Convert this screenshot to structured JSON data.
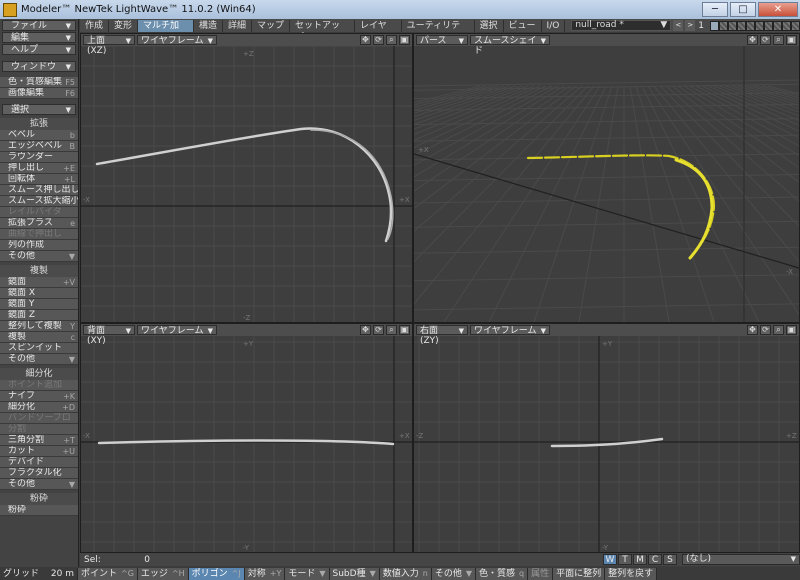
{
  "window": {
    "title": "Modeler™ NewTek LightWave™ 11.0.2 (Win64)",
    "min_label": "─",
    "max_label": "□",
    "close_label": "✕"
  },
  "tabs": [
    "作成",
    "変形",
    "マルチ加工",
    "構造",
    "詳細",
    "マップ",
    "セットアップ",
    "レイヤー",
    "ユーティリティ",
    "選択",
    "ビュー",
    "I/O"
  ],
  "active_tab": "マルチ加工",
  "object_name": "null_road *",
  "layer_index": "1",
  "sidebar": {
    "top_menus": [
      "ファイル",
      "編集",
      "ヘルプ"
    ],
    "window_menu": "ウィンドウ",
    "misc": [
      {
        "label": "色・質感編集",
        "shortcut": "F5"
      },
      {
        "label": "画像編集",
        "shortcut": "F6"
      }
    ],
    "select_menu": "選択",
    "groups": [
      {
        "title": "拡張",
        "items": [
          {
            "label": "ベベル",
            "shortcut": "b",
            "disabled": false
          },
          {
            "label": "エッジベベル",
            "shortcut": "B",
            "disabled": false
          },
          {
            "label": "ラウンダー",
            "shortcut": "",
            "disabled": false
          },
          {
            "label": "押し出し",
            "shortcut": "+E",
            "disabled": false
          },
          {
            "label": "回転体",
            "shortcut": "+L",
            "disabled": false
          },
          {
            "label": "スムース押し出し",
            "shortcut": "+F",
            "disabled": false
          },
          {
            "label": "スムース拡大縮小",
            "shortcut": "",
            "disabled": false
          },
          {
            "label": "レイルバイタ",
            "shortcut": "",
            "disabled": true
          },
          {
            "label": "拡張プラス",
            "shortcut": "e",
            "disabled": false
          },
          {
            "label": "曲線で押出し",
            "shortcut": "",
            "disabled": true
          },
          {
            "label": "列の作成",
            "shortcut": "",
            "disabled": false
          },
          {
            "label": "その他",
            "shortcut": "▼",
            "disabled": false
          }
        ]
      },
      {
        "title": "複製",
        "items": [
          {
            "label": "鏡面",
            "shortcut": "+V",
            "disabled": false
          },
          {
            "label": "鏡面 X",
            "shortcut": "",
            "disabled": false
          },
          {
            "label": "鏡面 Y",
            "shortcut": "",
            "disabled": false
          },
          {
            "label": "鏡面 Z",
            "shortcut": "",
            "disabled": false
          },
          {
            "label": "整列して複製",
            "shortcut": "Y",
            "disabled": false
          },
          {
            "label": "複製",
            "shortcut": "c",
            "disabled": false
          },
          {
            "label": "スピンイット",
            "shortcut": "",
            "disabled": false
          },
          {
            "label": "その他",
            "shortcut": "▼",
            "disabled": false
          }
        ]
      },
      {
        "title": "細分化",
        "items": [
          {
            "label": "ポイント追加",
            "shortcut": "",
            "disabled": true
          },
          {
            "label": "ナイフ",
            "shortcut": "+K",
            "disabled": false
          },
          {
            "label": "細分化",
            "shortcut": "+D",
            "disabled": false
          },
          {
            "label": "バンドソープロ",
            "shortcut": "",
            "disabled": true
          },
          {
            "label": "分割",
            "shortcut": "",
            "disabled": true
          },
          {
            "label": "三角分割",
            "shortcut": "+T",
            "disabled": false
          },
          {
            "label": "カット",
            "shortcut": "+U",
            "disabled": false
          },
          {
            "label": "デバイド",
            "shortcut": "",
            "disabled": false
          },
          {
            "label": "フラクタル化",
            "shortcut": "",
            "disabled": false
          },
          {
            "label": "その他",
            "shortcut": "▼",
            "disabled": false
          }
        ]
      },
      {
        "title": "粉砕",
        "items": [
          {
            "label": "粉砕",
            "shortcut": "",
            "disabled": false
          }
        ]
      }
    ]
  },
  "viewports": {
    "top_left": {
      "view": "上面 (XZ)",
      "mode": "ワイヤフレーム"
    },
    "top_right": {
      "view": "パース",
      "mode": "スムースシェイド"
    },
    "bottom_left": {
      "view": "背面 (XY)",
      "mode": "ワイヤフレーム"
    },
    "bottom_right": {
      "view": "右面 (ZY)",
      "mode": "ワイヤフレーム"
    }
  },
  "icons": {
    "move": "move-icon",
    "rotate": "rotate-icon",
    "zoom": "zoom-icon",
    "maximize": "maximize-icon"
  },
  "axes": {
    "plus_x": "+X",
    "minus_x": "-X",
    "plus_y": "+Y",
    "minus_y": "-Y",
    "plus_z": "+Z",
    "minus_z": "-Z"
  },
  "status": {
    "sel_label": "Sel:",
    "sel_value": "0",
    "wtmcs": [
      "W",
      "T",
      "M",
      "C",
      "S"
    ],
    "wtmcs_active": "W",
    "surface": "(なし)"
  },
  "bottom": {
    "grid_label": "グリッド",
    "grid_value": "20 m",
    "items": [
      {
        "label": "ポイント",
        "shortcut": "^G",
        "active": false,
        "dim": false
      },
      {
        "label": "エッジ",
        "shortcut": "^H",
        "active": false,
        "dim": false
      },
      {
        "label": "ポリゴン",
        "shortcut": "^J",
        "active": true,
        "dim": false
      },
      {
        "label": "対称",
        "shortcut": "+Y",
        "active": false,
        "dim": false
      },
      {
        "label": "モード",
        "shortcut": "▼",
        "active": false,
        "dim": false
      },
      {
        "label": "SubD種",
        "shortcut": "▼",
        "active": false,
        "dim": false
      },
      {
        "label": "数値入力",
        "shortcut": "n",
        "active": false,
        "dim": false
      },
      {
        "label": "その他",
        "shortcut": "▼",
        "active": false,
        "dim": false
      },
      {
        "label": "色・質感",
        "shortcut": "q",
        "active": false,
        "dim": false
      },
      {
        "label": "属性",
        "shortcut": "",
        "active": false,
        "dim": true
      },
      {
        "label": "平面に整列",
        "shortcut": "",
        "active": false,
        "dim": false
      },
      {
        "label": "整列を戻す",
        "shortcut": "",
        "active": false,
        "dim": false
      }
    ]
  },
  "colors": {
    "accent": "#5b86b0",
    "curve": "#d0d0d0",
    "curve_selected": "#d8d020",
    "grid": "#4a4a4a",
    "axis": "#202020"
  }
}
